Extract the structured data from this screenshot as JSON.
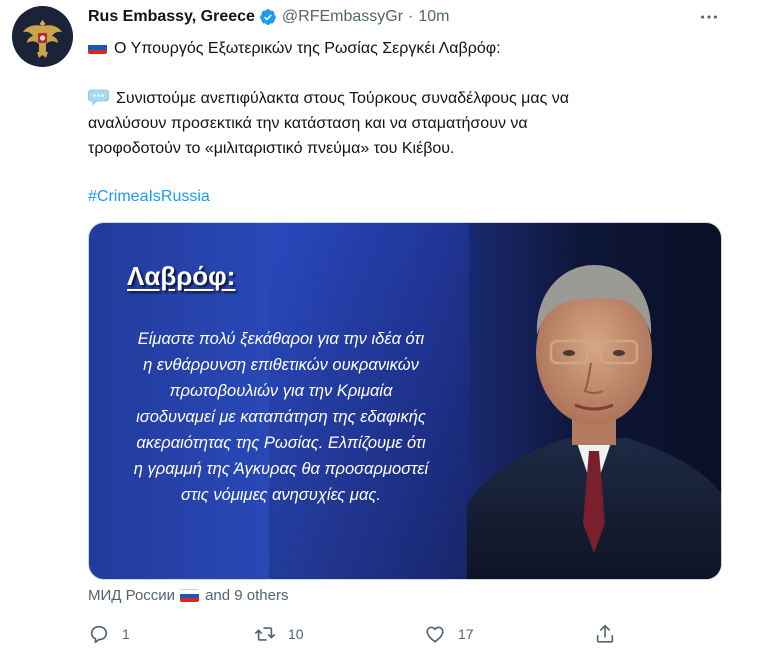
{
  "tweet": {
    "author_name": "Rus Embassy, Greece",
    "handle": "@RFEmbassyGr",
    "separator": "·",
    "time": "10m",
    "line1": "Ο Υπουργός Εξωτερικών της Ρωσίας Σεργκέι Λαβρόφ:",
    "line2": "Συνιστούμε ανεπιφύλακτα στους Τούρκους συναδέλφους μας να",
    "line3": "αναλύσουν προσεκτικά την κατάσταση και να σταματήσουν να",
    "line4": "τροφοδοτούν το «μιλιταριστικό πνεύμα» του Κιέβου.",
    "hashtag": "#CrimeaIsRussia",
    "icons": {
      "more": "more-icon",
      "verified": "verified-badge-icon",
      "flag": "russia-flag-icon",
      "speech": "speech-bubble-icon"
    }
  },
  "card": {
    "title": "Λαβρόφ:",
    "quote": "Είμαστε πολύ ξεκάθαροι για την ιδέα ότι\nη ενθάρρυνση επιθετικών ουκρανικών\nπρωτοβουλιών για την Κριμαία\nισοδυναμεί με καταπάτηση της εδαφικής\nακεραιότητας της Ρωσίας. Ελπίζουμε ότι\nη γραμμή της Άγκυρας θα προσαρμοστεί\nστις νόμιμες ανησυχίες μας."
  },
  "reactions": {
    "first": "МИД России",
    "rest": "and 9 others"
  },
  "actions": {
    "reply_count": "1",
    "retweet_count": "10",
    "like_count": "17"
  },
  "colors": {
    "accent": "#1d9bf0",
    "muted": "#536471",
    "text": "#0f1419"
  }
}
